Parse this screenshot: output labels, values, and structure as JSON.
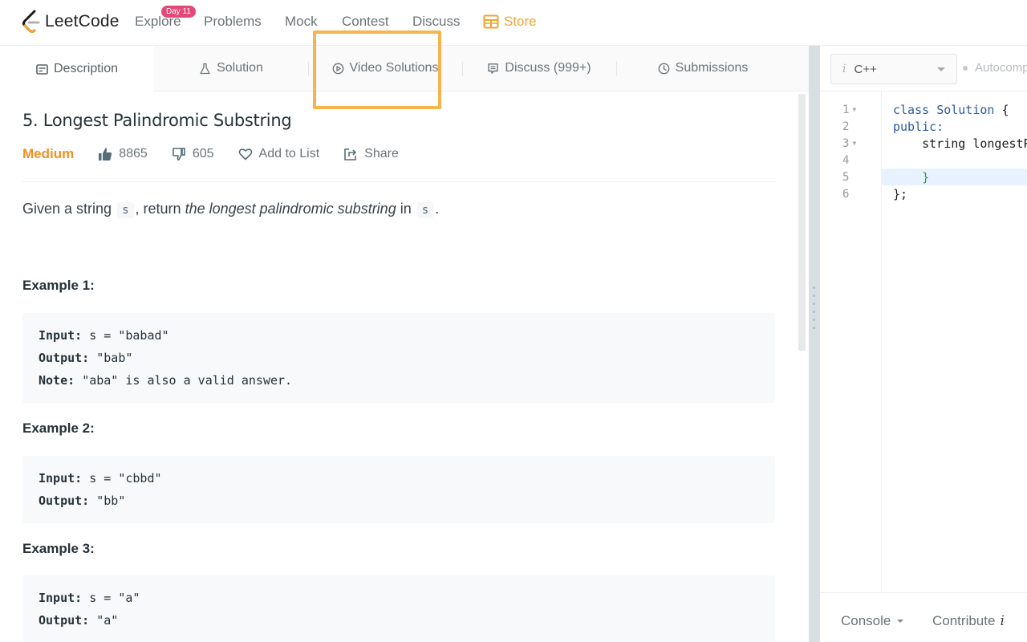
{
  "topnav": {
    "logo_text": "LeetCode",
    "links": [
      {
        "label": "Explore",
        "badge": "Day 11"
      },
      {
        "label": "Problems"
      },
      {
        "label": "Mock"
      },
      {
        "label": "Contest"
      },
      {
        "label": "Discuss"
      },
      {
        "label": "Store",
        "icon": "store-icon",
        "color": "#f0a433"
      }
    ]
  },
  "tabs": [
    {
      "label": "Description",
      "icon": "description-icon",
      "active": true
    },
    {
      "label": "Solution",
      "icon": "flask-icon"
    },
    {
      "label": "Video Solutions",
      "icon": "play-circle-icon",
      "highlighted": true
    },
    {
      "label": "Discuss (999+)",
      "icon": "comment-icon"
    },
    {
      "label": "Submissions",
      "icon": "clock-icon"
    }
  ],
  "problem": {
    "title": "5. Longest Palindromic Substring",
    "difficulty": "Medium",
    "difficulty_color": "#ef9027",
    "likes": "8865",
    "dislikes": "605",
    "add_to_list": "Add to List",
    "share": "Share",
    "statement": {
      "prefix": "Given a string",
      "var1": "s",
      "middle": ", return",
      "emphasis": "the longest palindromic substring",
      "in": "in",
      "var2": "s",
      "suffix": "."
    },
    "examples": [
      {
        "title": "Example 1:",
        "input_label": "Input:",
        "input": "s = \"babad\"",
        "output_label": "Output:",
        "output": "\"bab\"",
        "note_label": "Note:",
        "note": "\"aba\" is also a valid answer."
      },
      {
        "title": "Example 2:",
        "input_label": "Input:",
        "input": "s = \"cbbd\"",
        "output_label": "Output:",
        "output": "\"bb\""
      },
      {
        "title": "Example 3:",
        "input_label": "Input:",
        "input": "s = \"a\"",
        "output_label": "Output:",
        "output": "\"a\""
      }
    ]
  },
  "editor": {
    "language": "C++",
    "language_info_icon": "i",
    "autocomplete_label": "Autocomplete",
    "line_numbers": [
      "1",
      "2",
      "3",
      "4",
      "5",
      "6"
    ],
    "code": {
      "l1_kw": "class",
      "l1_name": "Solution",
      "l1_rest": " {",
      "l2": "public:",
      "l3": "    string longestPalindrome(string s) {",
      "l4": "",
      "l5": "    }",
      "l6": "};"
    },
    "console_label": "Console",
    "contribute_label": "Contribute",
    "contribute_icon": "i"
  },
  "colors": {
    "accent_store": "#f0a433",
    "badge": "#e3487a",
    "highlight_box": "#f7b34c"
  }
}
